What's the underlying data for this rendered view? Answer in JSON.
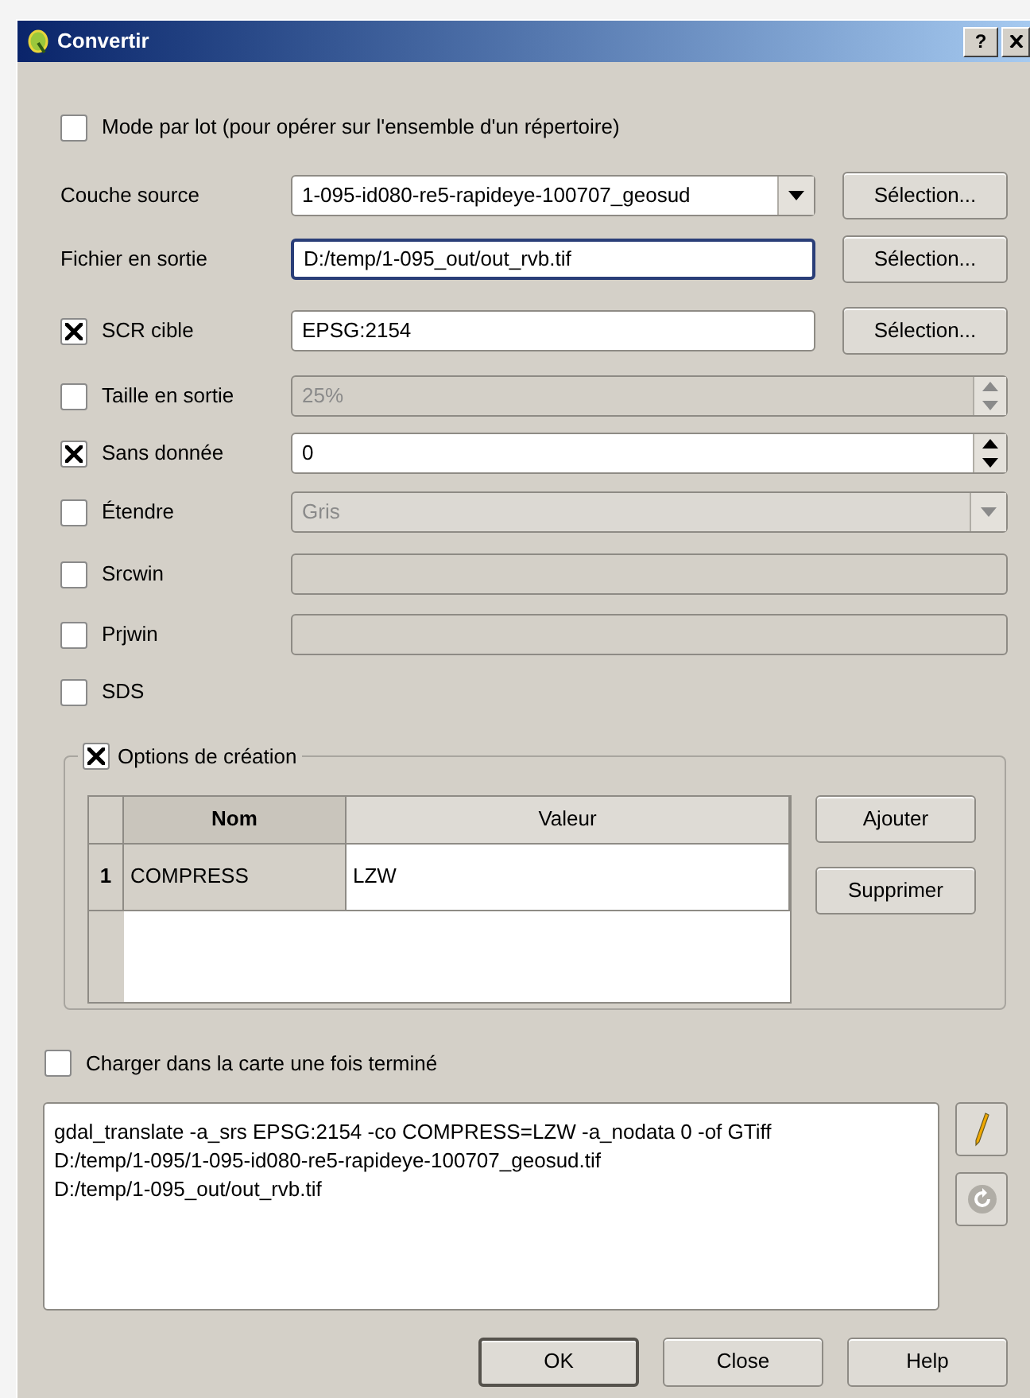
{
  "window": {
    "title": "Convertir",
    "help_button": "?"
  },
  "rows": [
    {
      "kind": "check",
      "label": "Mode par lot (pour opérer sur l'ensemble d'un répertoire)",
      "checked": false
    },
    {
      "kind": "combo",
      "label": "Couche source",
      "value": "1-095-id080-re5-rapideye-100707_geosud",
      "disabled": false,
      "button": "Sélection..."
    },
    {
      "kind": "text",
      "label": "Fichier en sortie",
      "value": "D:/temp/1-095_out/out_rvb.tif",
      "disabled": false,
      "focused": true,
      "button": "Sélection..."
    },
    {
      "kind": "text",
      "label": "SCR cible",
      "checked": true,
      "value": "EPSG:2154",
      "disabled": false,
      "focused": false,
      "button": "Sélection..."
    },
    {
      "kind": "spin",
      "label": "Taille en sortie",
      "checked": false,
      "value": "25%",
      "disabled": true
    },
    {
      "kind": "spin",
      "label": "Sans donnée",
      "checked": true,
      "value": "0",
      "disabled": false
    },
    {
      "kind": "combo",
      "label": "Étendre",
      "checked": false,
      "value": "Gris",
      "disabled": true
    },
    {
      "kind": "text",
      "label": "Srcwin",
      "checked": false,
      "disabled": true,
      "focused": false
    },
    {
      "kind": "text",
      "label": "Prjwin",
      "checked": false,
      "disabled": true,
      "focused": false
    },
    {
      "kind": "check",
      "label": "SDS",
      "checked": false
    }
  ],
  "creation_options": {
    "title": "Options de création",
    "checked": true,
    "columns": [
      {
        "label": "Nom",
        "selected": true
      },
      {
        "label": "Valeur",
        "selected": false
      }
    ],
    "rows": [
      {
        "number": "1",
        "cells": [
          "COMPRESS",
          "LZW"
        ]
      }
    ],
    "buttons": [
      "Ajouter",
      "Supprimer"
    ]
  },
  "load_when_done": {
    "label": "Charger dans la carte une fois terminé",
    "checked": false
  },
  "command": "gdal_translate -a_srs EPSG:2154 -co COMPRESS=LZW -a_nodata 0 -of GTiff\nD:/temp/1-095/1-095-id080-re5-rapideye-100707_geosud.tif\nD:/temp/1-095_out/out_rvb.tif",
  "command_buttons": [
    {
      "kind": "edit",
      "disabled": false
    },
    {
      "kind": "reset",
      "disabled": true
    }
  ],
  "buttons": [
    {
      "label": "OK",
      "default": true
    },
    {
      "label": "Close",
      "default": false
    },
    {
      "label": "Help",
      "default": false
    }
  ]
}
